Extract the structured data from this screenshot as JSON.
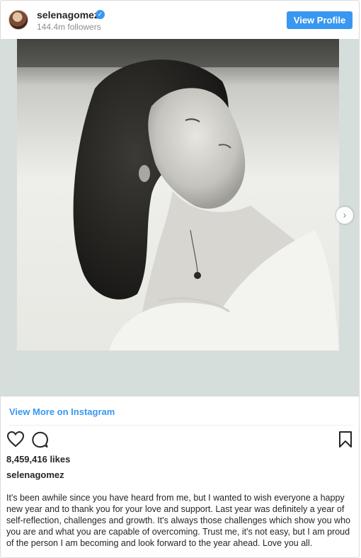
{
  "header": {
    "username": "selenagomez",
    "followers": "144.4m followers",
    "view_profile_label": "View Profile",
    "verified_color": "#3897f0"
  },
  "media": {
    "description": "black-and-white polaroid portrait",
    "next_icon": "chevron-right-icon"
  },
  "view_more_label": "View More on Instagram",
  "actions": {
    "icons": [
      "heart-icon",
      "comment-icon",
      "bookmark-icon"
    ]
  },
  "likes": "8,459,416 likes",
  "caption": {
    "username": "selenagomez",
    "text": "It's been awhile since you have heard from me, but I wanted to wish everyone a happy new year and to thank you for your love and support. Last year was definitely a year of self-reflection, challenges and growth. It's always those challenges which show you who you are and what you are capable of overcoming. Trust me, it's not easy, but I am proud of the person I am becoming and look forward to the year ahead. Love you all."
  },
  "colors": {
    "accent": "#3897f0",
    "text": "#262626",
    "muted": "#8e8e8e",
    "media_bg": "#d6dedb"
  }
}
